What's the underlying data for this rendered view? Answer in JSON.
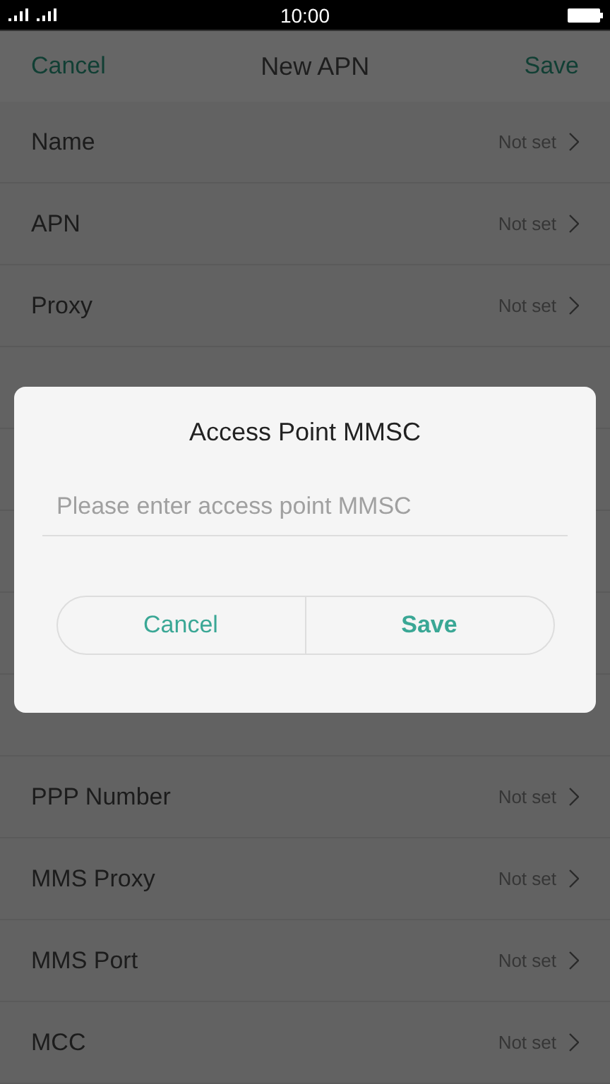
{
  "status_bar": {
    "time": "10:00"
  },
  "header": {
    "cancel": "Cancel",
    "title": "New APN",
    "save": "Save"
  },
  "rows_above_dialog": [
    {
      "label": "Name",
      "value": "Not set"
    },
    {
      "label": "APN",
      "value": "Not set"
    },
    {
      "label": "Proxy",
      "value": "Not set"
    }
  ],
  "rows_below_dialog": [
    {
      "label": "PPP Number",
      "value": "Not set"
    },
    {
      "label": "MMS Proxy",
      "value": "Not set"
    },
    {
      "label": "MMS Port",
      "value": "Not set"
    },
    {
      "label": "MCC",
      "value": "Not set"
    }
  ],
  "dialog": {
    "title": "Access Point MMSC",
    "input": {
      "placeholder": "Please enter access point MMSC"
    },
    "buttons": [
      "Cancel",
      "Save"
    ]
  }
}
